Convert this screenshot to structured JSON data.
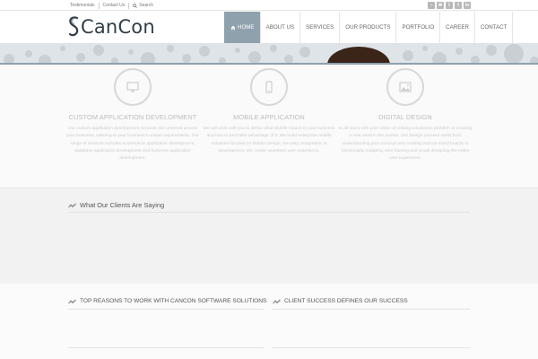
{
  "topbar": {
    "links": [
      "Testimonials",
      "Contact Us"
    ],
    "search_label": "Search",
    "socials": [
      {
        "icon": "rss-icon",
        "glyph": "◔"
      },
      {
        "icon": "email-icon",
        "glyph": "✉"
      },
      {
        "icon": "twitter-icon",
        "glyph": "t"
      },
      {
        "icon": "facebook-icon",
        "glyph": "f"
      },
      {
        "icon": "linkedin-icon",
        "glyph": "in"
      }
    ]
  },
  "header": {
    "logo_text": "CanCon",
    "nav": [
      {
        "label": "Home",
        "active": true
      },
      {
        "label": "About Us"
      },
      {
        "label": "Services"
      },
      {
        "label": "Our Products"
      },
      {
        "label": "Portfolio"
      },
      {
        "label": "Career"
      },
      {
        "label": "Contact"
      }
    ]
  },
  "services": [
    {
      "icon": "monitor-icon",
      "title": "CUSTOM APPLICATION DEVELOPMENT",
      "desc": "Our custom application development services are centered around your business, catering to your business's unique requirements. Our range of services includes ecommerce application development, database application development and business application development."
    },
    {
      "icon": "mobile-icon",
      "title": "MOBILE APPLICATION",
      "desc": "We will work with you to define what Mobile means to your business and how to best take advantage of it. We build enterprise mobile solutions focused on Mobile Design, Security, Integration, & Development. We create seamless user experience."
    },
    {
      "icon": "image-icon",
      "title": "DIGITAL DESIGN",
      "desc": "In all stuns with your vision of solving a business problem or creating a new need in the market. Our Design process starts from understanding your concept and creating various mood boards to functionality mapping, wire framing and visual designing the entire user experience."
    }
  ],
  "clients": {
    "heading": "What Our Clients Are Saying"
  },
  "bottom": {
    "left_heading": "TOP REASONS TO WORK WITH CANCON SOFTWARE SOLUTIONS",
    "right_heading": "CLIENT SUCCESS DEFINES OUR SUCCESS"
  },
  "colors": {
    "nav_active": "#8fa1ad",
    "hero_bg": "#dfe4e8",
    "dots": "#c8cfd5",
    "logo_text": "#2f3d4a"
  }
}
